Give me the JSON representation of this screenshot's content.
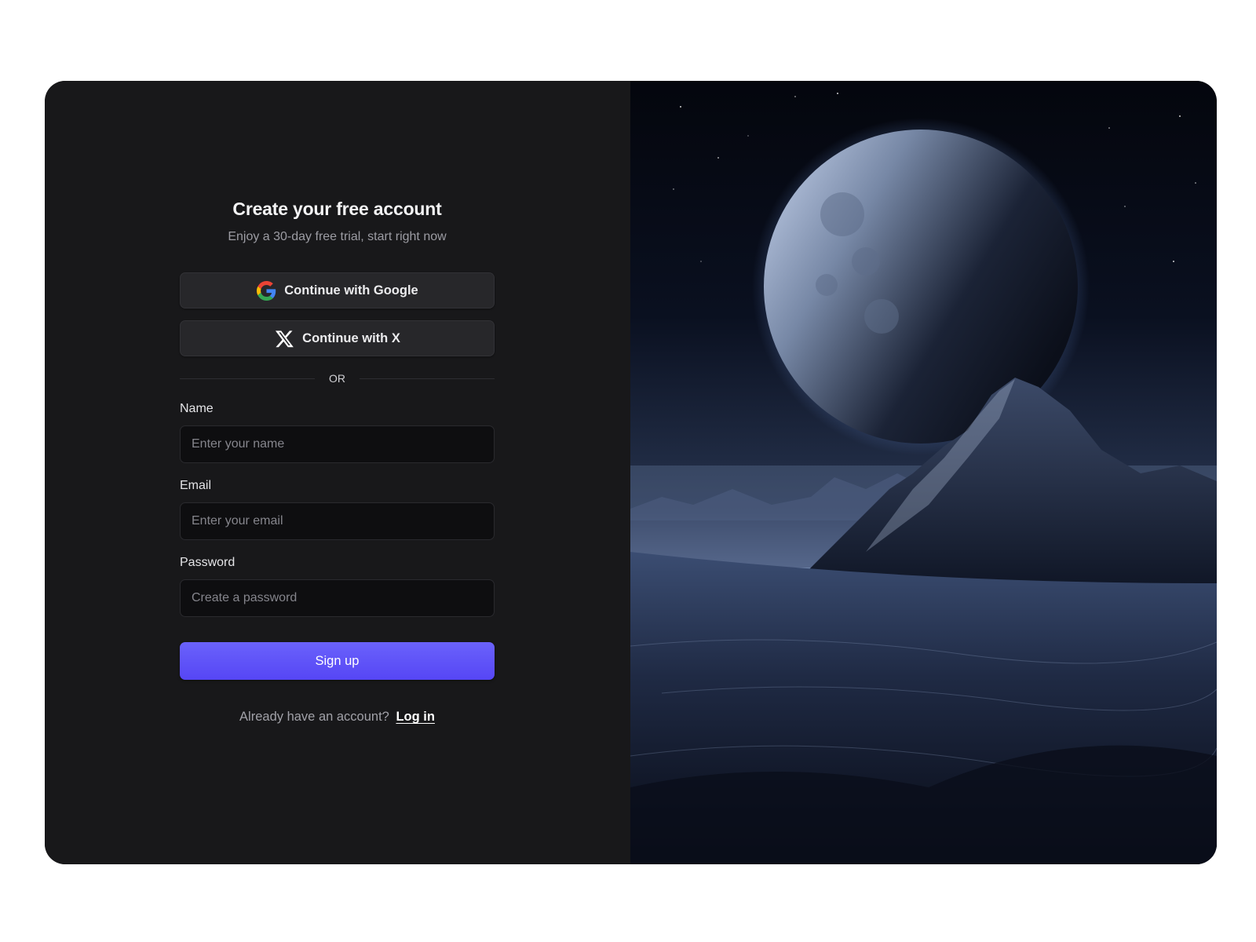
{
  "header": {
    "title": "Create your free account",
    "subtitle": "Enjoy a 30-day free trial, start right now"
  },
  "social": {
    "google_label": "Continue with Google",
    "google_icon": "google-icon",
    "x_label": "Continue with X",
    "x_icon": "x-logo-icon"
  },
  "divider": {
    "text": "OR"
  },
  "fields": {
    "name": {
      "label": "Name",
      "placeholder": "Enter your name",
      "value": ""
    },
    "email": {
      "label": "Email",
      "placeholder": "Enter your email",
      "value": ""
    },
    "password": {
      "label": "Password",
      "placeholder": "Create a password",
      "value": ""
    }
  },
  "actions": {
    "signup_label": "Sign up"
  },
  "footer": {
    "prompt": "Already have an account?",
    "login_label": "Log in"
  },
  "colors": {
    "panel": "#18181a",
    "accent": "#5b4ff7",
    "input_bg": "#0e0e10"
  }
}
